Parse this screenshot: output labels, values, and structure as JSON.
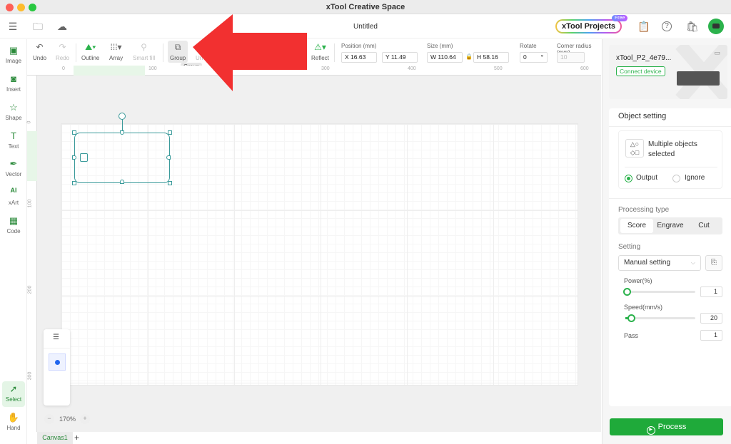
{
  "app": {
    "title": "xTool Creative Space",
    "document_title": "Untitled"
  },
  "window_controls": {
    "close_color": "#fe5f57",
    "minimize_color": "#febc2e",
    "zoom_color": "#28c840"
  },
  "header": {
    "icons": [
      "menu-settings-icon",
      "folder-icon",
      "cloud-icon"
    ],
    "projects_button": "xTool Projects",
    "projects_badge": "Free",
    "right_icons": [
      "clipboard-icon",
      "help-icon",
      "shop-icon",
      "avatar-robot-icon"
    ]
  },
  "left_tools": [
    {
      "label": "Image",
      "icon": "image-icon"
    },
    {
      "label": "Insert",
      "icon": "insert-icon"
    },
    {
      "label": "Shape",
      "icon": "shape-icon"
    },
    {
      "label": "Text",
      "icon": "text-icon"
    },
    {
      "label": "Vector",
      "icon": "pen-icon"
    },
    {
      "label": "xArt",
      "icon": "ai-icon"
    },
    {
      "label": "Code",
      "icon": "barcode-icon"
    }
  ],
  "bottom_tools": [
    {
      "label": "Select",
      "icon": "cursor-icon",
      "active": true
    },
    {
      "label": "Hand",
      "icon": "hand-icon",
      "active": false
    }
  ],
  "toolbar": {
    "undo": "Undo",
    "redo": "Redo",
    "outline": "Outline",
    "array": "Array",
    "smart_fill": "Smart fill",
    "group": "Group",
    "ungroup": "Un",
    "reflect": "Reflect",
    "position_label": "Position (mm)",
    "x": "X 16.63",
    "y": "Y 11.49",
    "size_label": "Size (mm)",
    "w": "W 110.64",
    "h": "H 58.16",
    "rotate_label": "Rotate",
    "rotate_value": "0",
    "rotate_unit": "°",
    "corner_label": "Corner radius (mm)",
    "corner_value": "10",
    "tooltip": "Group"
  },
  "rulers": {
    "horizontal": [
      "0",
      "100",
      "300",
      "400",
      "500",
      "600"
    ],
    "vertical": [
      "0",
      "100",
      "200",
      "300"
    ]
  },
  "canvas": {
    "zoom": "170%",
    "tab": "Canvas1",
    "add_tab": "+"
  },
  "device": {
    "name": "xTool_P2_4e79...",
    "connect": "Connect device"
  },
  "object_setting": {
    "title": "Object setting",
    "selection": "Multiple objects selected",
    "output_label": "Output",
    "ignore_label": "Ignore",
    "output_selected": true,
    "processing_type_label": "Processing type",
    "processing_types": [
      "Score",
      "Engrave",
      "Cut"
    ],
    "processing_selected": "Score",
    "setting_label": "Setting",
    "setting_value": "Manual setting",
    "power_label": "Power(%)",
    "power": "1",
    "power_fraction": 0.01,
    "speed_label": "Speed(mm/s)",
    "speed": "20",
    "speed_fraction": 0.04,
    "pass_label": "Pass",
    "pass": "1"
  },
  "process_button": "Process",
  "accent_color": "#2bb24c",
  "annotation": {
    "type": "red-arrow",
    "points_to": "group-button"
  }
}
